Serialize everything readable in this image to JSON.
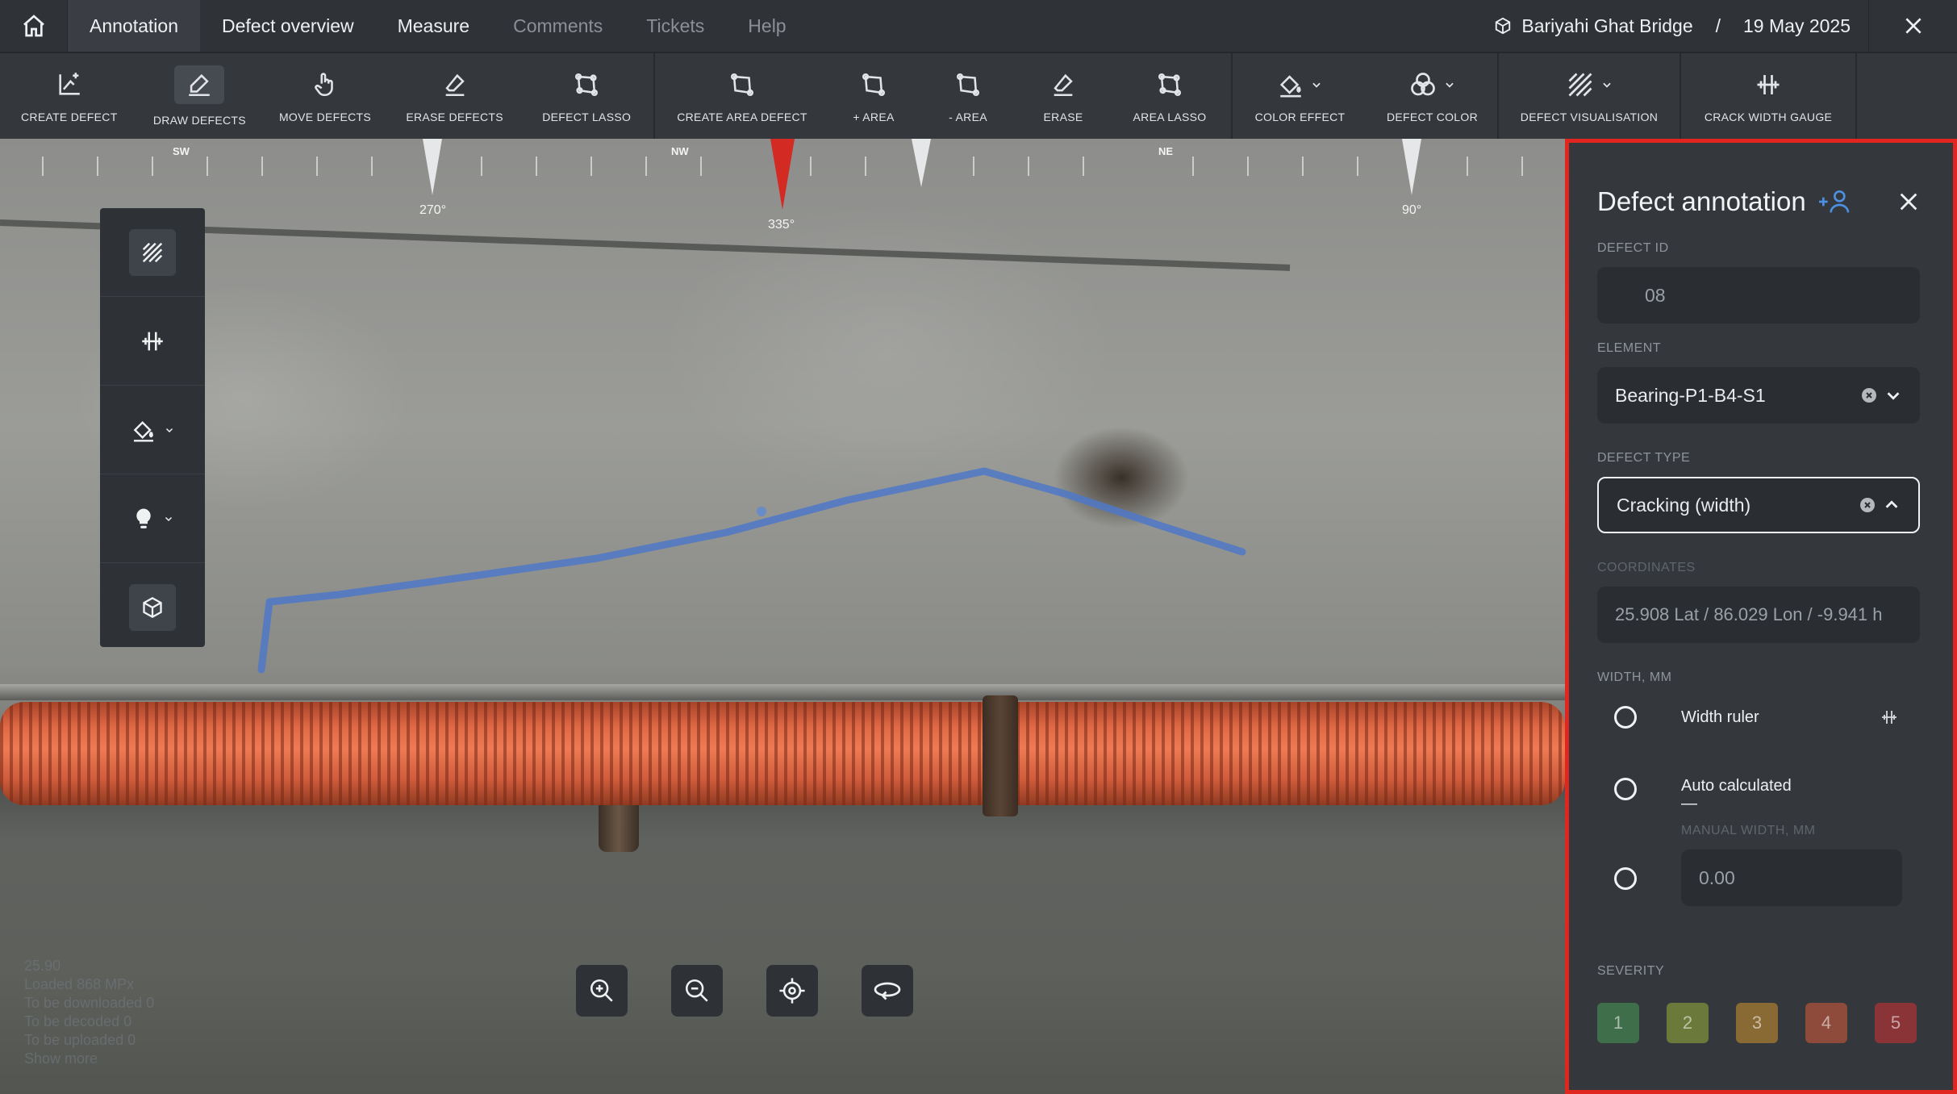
{
  "nav": {
    "tabs": [
      {
        "label": "Annotation"
      },
      {
        "label": "Defect overview"
      },
      {
        "label": "Measure"
      },
      {
        "label": "Comments"
      },
      {
        "label": "Tickets"
      },
      {
        "label": "Help"
      }
    ],
    "project": "Bariyahi Ghat Bridge",
    "separator": "/",
    "date": "19 May 2025"
  },
  "toolbar": {
    "tools": [
      {
        "label": "CREATE DEFECT",
        "icon": "create-defect-icon"
      },
      {
        "label": "DRAW DEFECTS",
        "icon": "draw-defects-icon",
        "selected": true
      },
      {
        "label": "MOVE DEFECTS",
        "icon": "move-defects-icon"
      },
      {
        "label": "ERASE DEFECTS",
        "icon": "erase-defects-icon"
      },
      {
        "label": "DEFECT LASSO",
        "icon": "lasso-icon"
      },
      {
        "label": "CREATE AREA DEFECT",
        "icon": "area-icon"
      },
      {
        "label": "+ AREA",
        "icon": "area-add-icon"
      },
      {
        "label": "- AREA",
        "icon": "area-remove-icon"
      },
      {
        "label": "ERASE",
        "icon": "eraser-icon"
      },
      {
        "label": "AREA LASSO",
        "icon": "area-lasso-icon"
      },
      {
        "label": "COLOR EFFECT",
        "icon": "paint-bucket-icon"
      },
      {
        "label": "DEFECT COLOR",
        "icon": "color-circles-icon"
      },
      {
        "label": "DEFECT VISUALISATION",
        "icon": "hatch-icon"
      },
      {
        "label": "CRACK WIDTH GAUGE",
        "icon": "crack-gauge-icon"
      }
    ]
  },
  "compass": {
    "labels": [
      "SW",
      "NW",
      "NE"
    ],
    "degrees": [
      "270°",
      "335°",
      "90°"
    ]
  },
  "overlay_info": [
    "25.90",
    "Loaded 868 MPx",
    "To be downloaded 0",
    "To be decoded 0",
    "To be uploaded 0",
    "Show more"
  ],
  "panel": {
    "title": "Defect annotation",
    "defect_id_label": "DEFECT ID",
    "defect_id": "08",
    "element_label": "ELEMENT",
    "element": "Bearing-P1-B4-S1",
    "defect_type_label": "DEFECT TYPE",
    "defect_type": "Cracking (width)",
    "coordinates_label": "COORDINATES",
    "coordinates": "25.908 Lat / 86.029 Lon / -9.941 h",
    "width_label": "WIDTH, MM",
    "width_ruler": "Width ruler",
    "auto_calculated": "Auto calculated",
    "auto_value": "—",
    "manual_width_label": "MANUAL WIDTH, MM",
    "manual_width": "0.00",
    "severity_label": "SEVERITY",
    "severity": [
      {
        "label": "1",
        "color": "#3f6e4a"
      },
      {
        "label": "2",
        "color": "#6b7a3a"
      },
      {
        "label": "3",
        "color": "#8a6a34"
      },
      {
        "label": "4",
        "color": "#8e4a3a"
      },
      {
        "label": "5",
        "color": "#8a3438"
      }
    ]
  },
  "colors": {
    "accent_blue": "#4d8fe0",
    "highlight_red": "#e0261f",
    "crack_line": "#4f78c8"
  }
}
